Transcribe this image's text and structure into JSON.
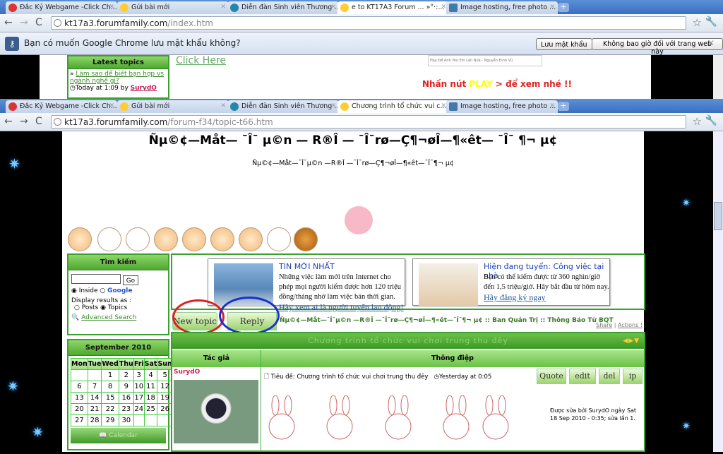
{
  "window1": {
    "tabs": [
      {
        "title": "Đắc Kỷ Webgame -Click Ch...",
        "icon": "s-logo-icon"
      },
      {
        "title": "Gửi bài mới",
        "icon": "smiley-icon"
      },
      {
        "title": "Diễn đàn Sinh viên Thương ...",
        "icon": "globe-icon"
      },
      {
        "title": "e to KT17A3 Forum ... »°·:...",
        "icon": "smiley-icon",
        "active": true
      },
      {
        "title": "Image hosting, free photo ...",
        "icon": "image-icon"
      }
    ],
    "url_host": "kt17a3.forumfamily.com",
    "url_path": "/index.htm",
    "infobar": {
      "message": "Bạn có muốn Google Chrome lưu mật khẩu không?",
      "save": "Lưu mật khẩu",
      "never": "Không bao giờ đối với trang web này"
    },
    "latest_topics": {
      "title": "Latest topics",
      "link": "Làm sao để biết bạn hợp vs ngành nghề gì?",
      "time": "Today at 1:09 by",
      "author": "SurydO"
    },
    "click_here": "Click Here",
    "player_caption": "Hãy Để Anh Yêu Em Lần Nữa - Nguyễn Đình Vũ",
    "play_msg": {
      "a": "Nhấn nút ",
      "b": "PLAY",
      "c": " > để xem nhé !!"
    }
  },
  "window2": {
    "tabs": [
      {
        "title": "Đắc Kỷ Webgame -Click Ch...",
        "icon": "s-logo-icon"
      },
      {
        "title": "Gửi bài mới",
        "icon": "smiley-icon"
      },
      {
        "title": "Diễn đàn Sinh viên Thương ...",
        "icon": "globe-icon"
      },
      {
        "title": "Chương trình tổ chức vui c...",
        "icon": "smiley-icon",
        "active": true
      },
      {
        "title": "Image hosting, free photo ...",
        "icon": "image-icon"
      }
    ],
    "url_host": "kt17a3.forumfamily.com",
    "url_path": "/forum-f34/topic-t66.htm",
    "site_title": "Ñµ©¢—Måt— ¯Î¯ µ©n — R®Î — ¯Î¯rø—Ç¶¬øÎ—¶«êt— ¯Î¯ ¶¬ µ¢",
    "site_subtitle": "Ñµ©¢—Måt—¯Î¯µ©n —R®Î —¯Î¯rø—Ç¶¬øÎ—¶«êt—¯Î¯¶¬ µ¢",
    "search": {
      "title": "Tìm kiếm",
      "go": "Go",
      "inside": "Inside",
      "google": "Google",
      "display": "Display results as :",
      "posts": "Posts",
      "topics": "Topics",
      "advanced": "Advanced Search"
    },
    "calendar": {
      "title": "September 2010",
      "days": [
        "Mon",
        "Tue",
        "Wed",
        "Thu",
        "Fri",
        "Sat",
        "Sun"
      ],
      "weeks": [
        [
          "",
          "",
          "1",
          "2",
          "3",
          "4",
          "5"
        ],
        [
          "6",
          "7",
          "8",
          "9",
          "10",
          "11",
          "12"
        ],
        [
          "13",
          "14",
          "15",
          "16",
          "17",
          "18",
          "19"
        ],
        [
          "20",
          "21",
          "22",
          "23",
          "24",
          "25",
          "26"
        ],
        [
          "27",
          "28",
          "29",
          "30",
          "",
          "",
          ""
        ]
      ],
      "footer": "Calendar"
    },
    "ads": [
      {
        "title": "TIN MỚI NHẤT",
        "body": "Những việc làm mới trên Internet cho phép mọi người kiếm được hơn 120 triệu đồng/tháng nhờ làm việc bán thời gian.",
        "link": "Hãy xem ai là người tuyển lao động!"
      },
      {
        "title": "Hiện đang tuyển: Công việc tại nhà",
        "body": "Bạn có thể kiếm được từ 360 nghìn/giờ đến 1,5 triệu/giờ. Hãy bắt đầu từ hôm nay.",
        "link": "Hãy đăng ký ngay"
      }
    ],
    "new_topic": "New topic",
    "reply": "Reply",
    "breadcrumb": [
      "Ñµ©¢—Måt—¯Î¯µ©n —R®Î —¯Î¯rø—Ç¶¬øÎ—¶«êt—¯Î¯¶¬ µ¢",
      "Ban Quản Trị",
      "Thông Báo Từ BQT"
    ],
    "breadcrumb_sep": " :: ",
    "share": "Share",
    "actions": "Actions !",
    "topic_title": "Chương trình tổ chức vui chơi trung thu đêy",
    "col_author": "Tác giả",
    "col_message": "Thông điệp",
    "post": {
      "author": "SurydO",
      "subject": "Tiêu đề: Chương trình tổ chức vui chơi trung thu đêy",
      "time": "Yesterday at 0:05",
      "buttons": [
        "Quote",
        "edit",
        "del",
        "ip"
      ],
      "edited": "Được sửa bởi SurydO ngày Sat 18 Sep 2010 - 0:35; sửa lần 1."
    },
    "colors": {
      "green": "#3aa12f",
      "red_circle": "#e02020",
      "blue_circle": "#1a2fd0"
    }
  }
}
